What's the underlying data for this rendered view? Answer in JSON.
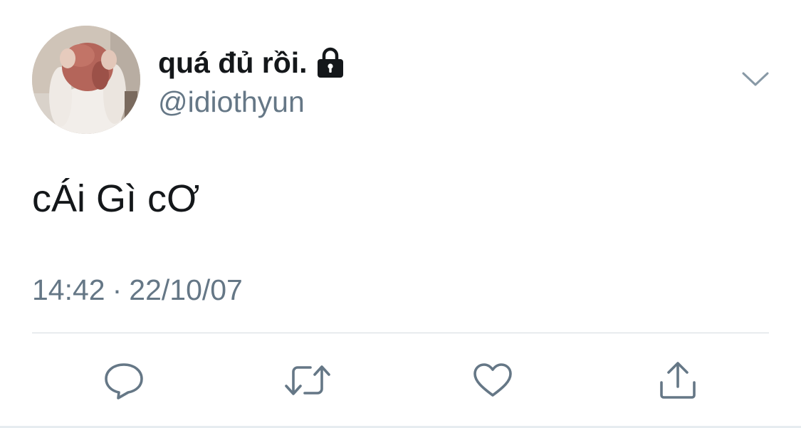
{
  "tweet": {
    "display_name": "quá đủ rồi.",
    "handle": "@idiothyun",
    "text": "cÁi Gì cƠ",
    "time": "14:42",
    "separator": "·",
    "date": "22/10/07"
  },
  "icons": {
    "lock": "lock-icon",
    "chevron": "chevron-down-icon",
    "reply": "reply-icon",
    "retweet": "retweet-icon",
    "like": "heart-icon",
    "share": "share-icon"
  },
  "colors": {
    "text_primary": "#14171a",
    "text_secondary": "#657786",
    "icon": "#657786",
    "divider": "#d4dbe0"
  }
}
